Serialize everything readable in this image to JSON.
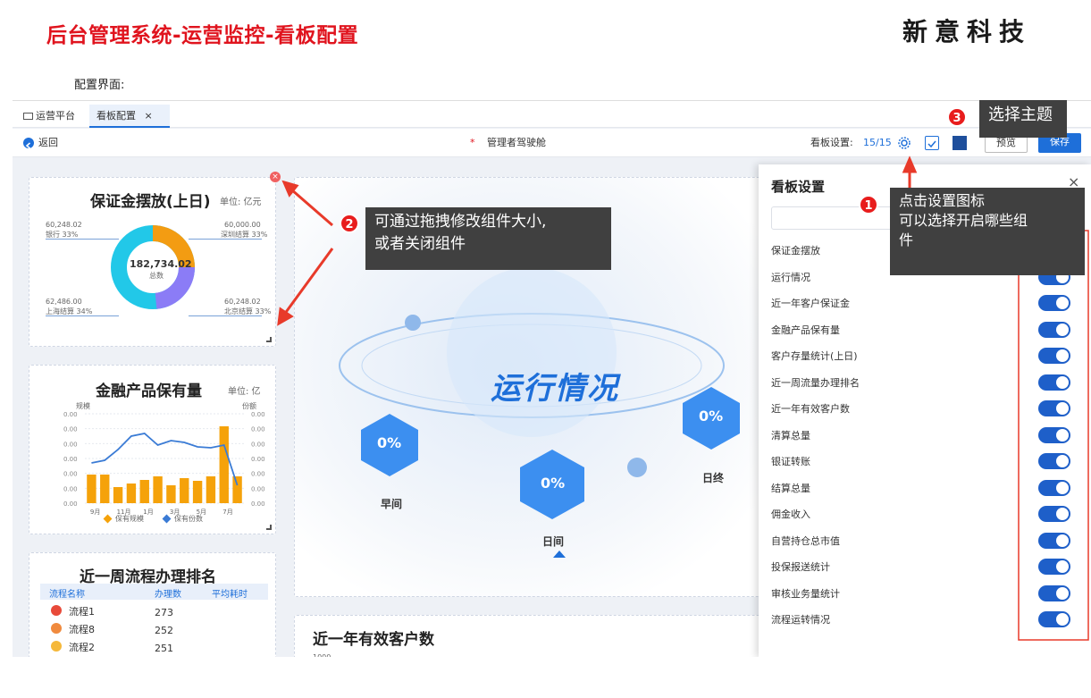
{
  "slide": {
    "title": "后台管理系统-运营监控-看板配置",
    "brand": "新意科技",
    "section_label": "配置界面:"
  },
  "tabs": [
    {
      "label": "运营平台"
    },
    {
      "label": "看板配置",
      "close": "×"
    }
  ],
  "toolbar": {
    "back": "返回",
    "required_mark": "*",
    "board_name": "管理者驾驶舱",
    "setting_label": "看板设置:",
    "setting_count": "15/15",
    "preview": "预览",
    "save": "保存"
  },
  "widgets": {
    "deposit": {
      "title": "保证金摆放(上日)",
      "unit": "单位: 亿元",
      "center_value": "182,734.02",
      "center_label": "总数",
      "labels": [
        {
          "value": "60,248.02",
          "name": "银行 33%"
        },
        {
          "value": "60,000.00",
          "name": "深圳结算 33%"
        },
        {
          "value": "62,486.00",
          "name": "上海结算 34%"
        },
        {
          "value": "60,248.02",
          "name": "北京结算 33%"
        }
      ]
    },
    "products": {
      "title": "金融产品保有量",
      "unit": "单位: 亿",
      "y_left_label": "规模",
      "y_right_label": "份额",
      "y_ticks": [
        "0.00",
        "0.00",
        "0.00",
        "0.00",
        "0.00",
        "0.00",
        "0.00"
      ],
      "x_ticks": [
        "9月",
        "11月",
        "1月",
        "3月",
        "5月",
        "7月"
      ],
      "legend": [
        "保有规模",
        "保有份数"
      ]
    },
    "ranking": {
      "title": "近一周流程办理排名",
      "headers": [
        "流程名称",
        "办理数",
        "平均耗时"
      ],
      "rows": [
        {
          "name": "流程1",
          "count": "273"
        },
        {
          "name": "流程8",
          "count": "252"
        },
        {
          "name": "流程2",
          "count": "251"
        }
      ]
    },
    "running": {
      "title": "运行情况",
      "hexes": [
        {
          "value": "0%",
          "label": "早间"
        },
        {
          "value": "0%",
          "label": "日间"
        },
        {
          "value": "0%",
          "label": "日终"
        }
      ]
    },
    "customers": {
      "title": "近一年有效客户数",
      "tick": "1000"
    }
  },
  "drawer": {
    "title": "看板设置",
    "close": "×",
    "items": [
      "保证金摆放",
      "运行情况",
      "近一年客户保证金",
      "金融产品保有量",
      "客户存量统计(上日)",
      "近一周流量办理排名",
      "近一年有效客户数",
      "清算总量",
      "银证转账",
      "结算总量",
      "佣金收入",
      "自营持仓总市值",
      "投保报送统计",
      "审核业务量统计",
      "流程运转情况"
    ]
  },
  "callouts": {
    "c1": {
      "badge": "1",
      "text_line1": "点击设置图标",
      "text_line2": "可以选择开启哪些组",
      "text_line3": "件"
    },
    "c2": {
      "badge": "2",
      "text_line1": "可通过拖拽修改组件大小,",
      "text_line2": "或者关闭组件"
    },
    "c3": {
      "badge": "3",
      "text": "选择主题"
    }
  },
  "chart_data": {
    "type": "bar",
    "categories": [
      "9月",
      "",
      "11月",
      "",
      "1月",
      "",
      "3月",
      "",
      "5月",
      "",
      "7月",
      ""
    ],
    "series": [
      {
        "name": "保有规模",
        "type": "bar",
        "values": [
          0.32,
          0.32,
          0.18,
          0.22,
          0.26,
          0.3,
          0.2,
          0.28,
          0.25,
          0.3,
          0.86,
          0.3
        ]
      },
      {
        "name": "保有份数",
        "type": "line",
        "values": [
          0.45,
          0.48,
          0.6,
          0.75,
          0.78,
          0.65,
          0.7,
          0.68,
          0.63,
          0.62,
          0.65,
          0.2
        ]
      }
    ],
    "colors": {
      "bar": "#f5a20a",
      "line": "#3a7bd5"
    }
  },
  "colors": {
    "accent": "#1e6fd9",
    "red": "#e0141e",
    "toggle": "#1e5fc9"
  }
}
